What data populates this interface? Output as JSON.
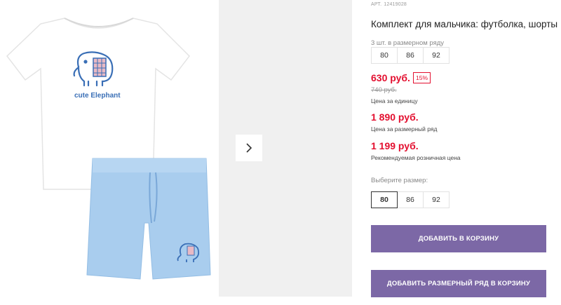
{
  "gallery": {
    "tshirt_print_text": "cute Elephant",
    "next_icon": "chevron-right-icon"
  },
  "product": {
    "article_label": "АРТ.",
    "article_number": "12419028",
    "title": "Комплект для мальчика: футболка, шорты",
    "pack_label": "3 шт. в размерном ряду",
    "pack_sizes": [
      "80",
      "86",
      "92"
    ],
    "unit_price": "630 руб.",
    "discount": "15%",
    "old_price": "740 руб.",
    "unit_price_caption": "Цена за единицу",
    "pack_price": "1 890 руб.",
    "pack_price_caption": "Цена за размерный ряд",
    "retail_price": "1 199 руб.",
    "retail_price_caption": "Рекомендуемая розничная цена",
    "choose_size_label": "Выберите размер:",
    "sizes": [
      "80",
      "86",
      "92"
    ],
    "selected_size": "80",
    "add_to_cart": "ДОБАВИТЬ В КОРЗИНУ",
    "add_pack_to_cart": "ДОБАВИТЬ РАЗМЕРНЫЙ РЯД В КОРЗИНУ"
  },
  "colors": {
    "price_red": "#e30f2f",
    "button_purple": "#7c68a6",
    "shorts_blue": "#a9cdee",
    "print_blue": "#3a6fb6"
  }
}
